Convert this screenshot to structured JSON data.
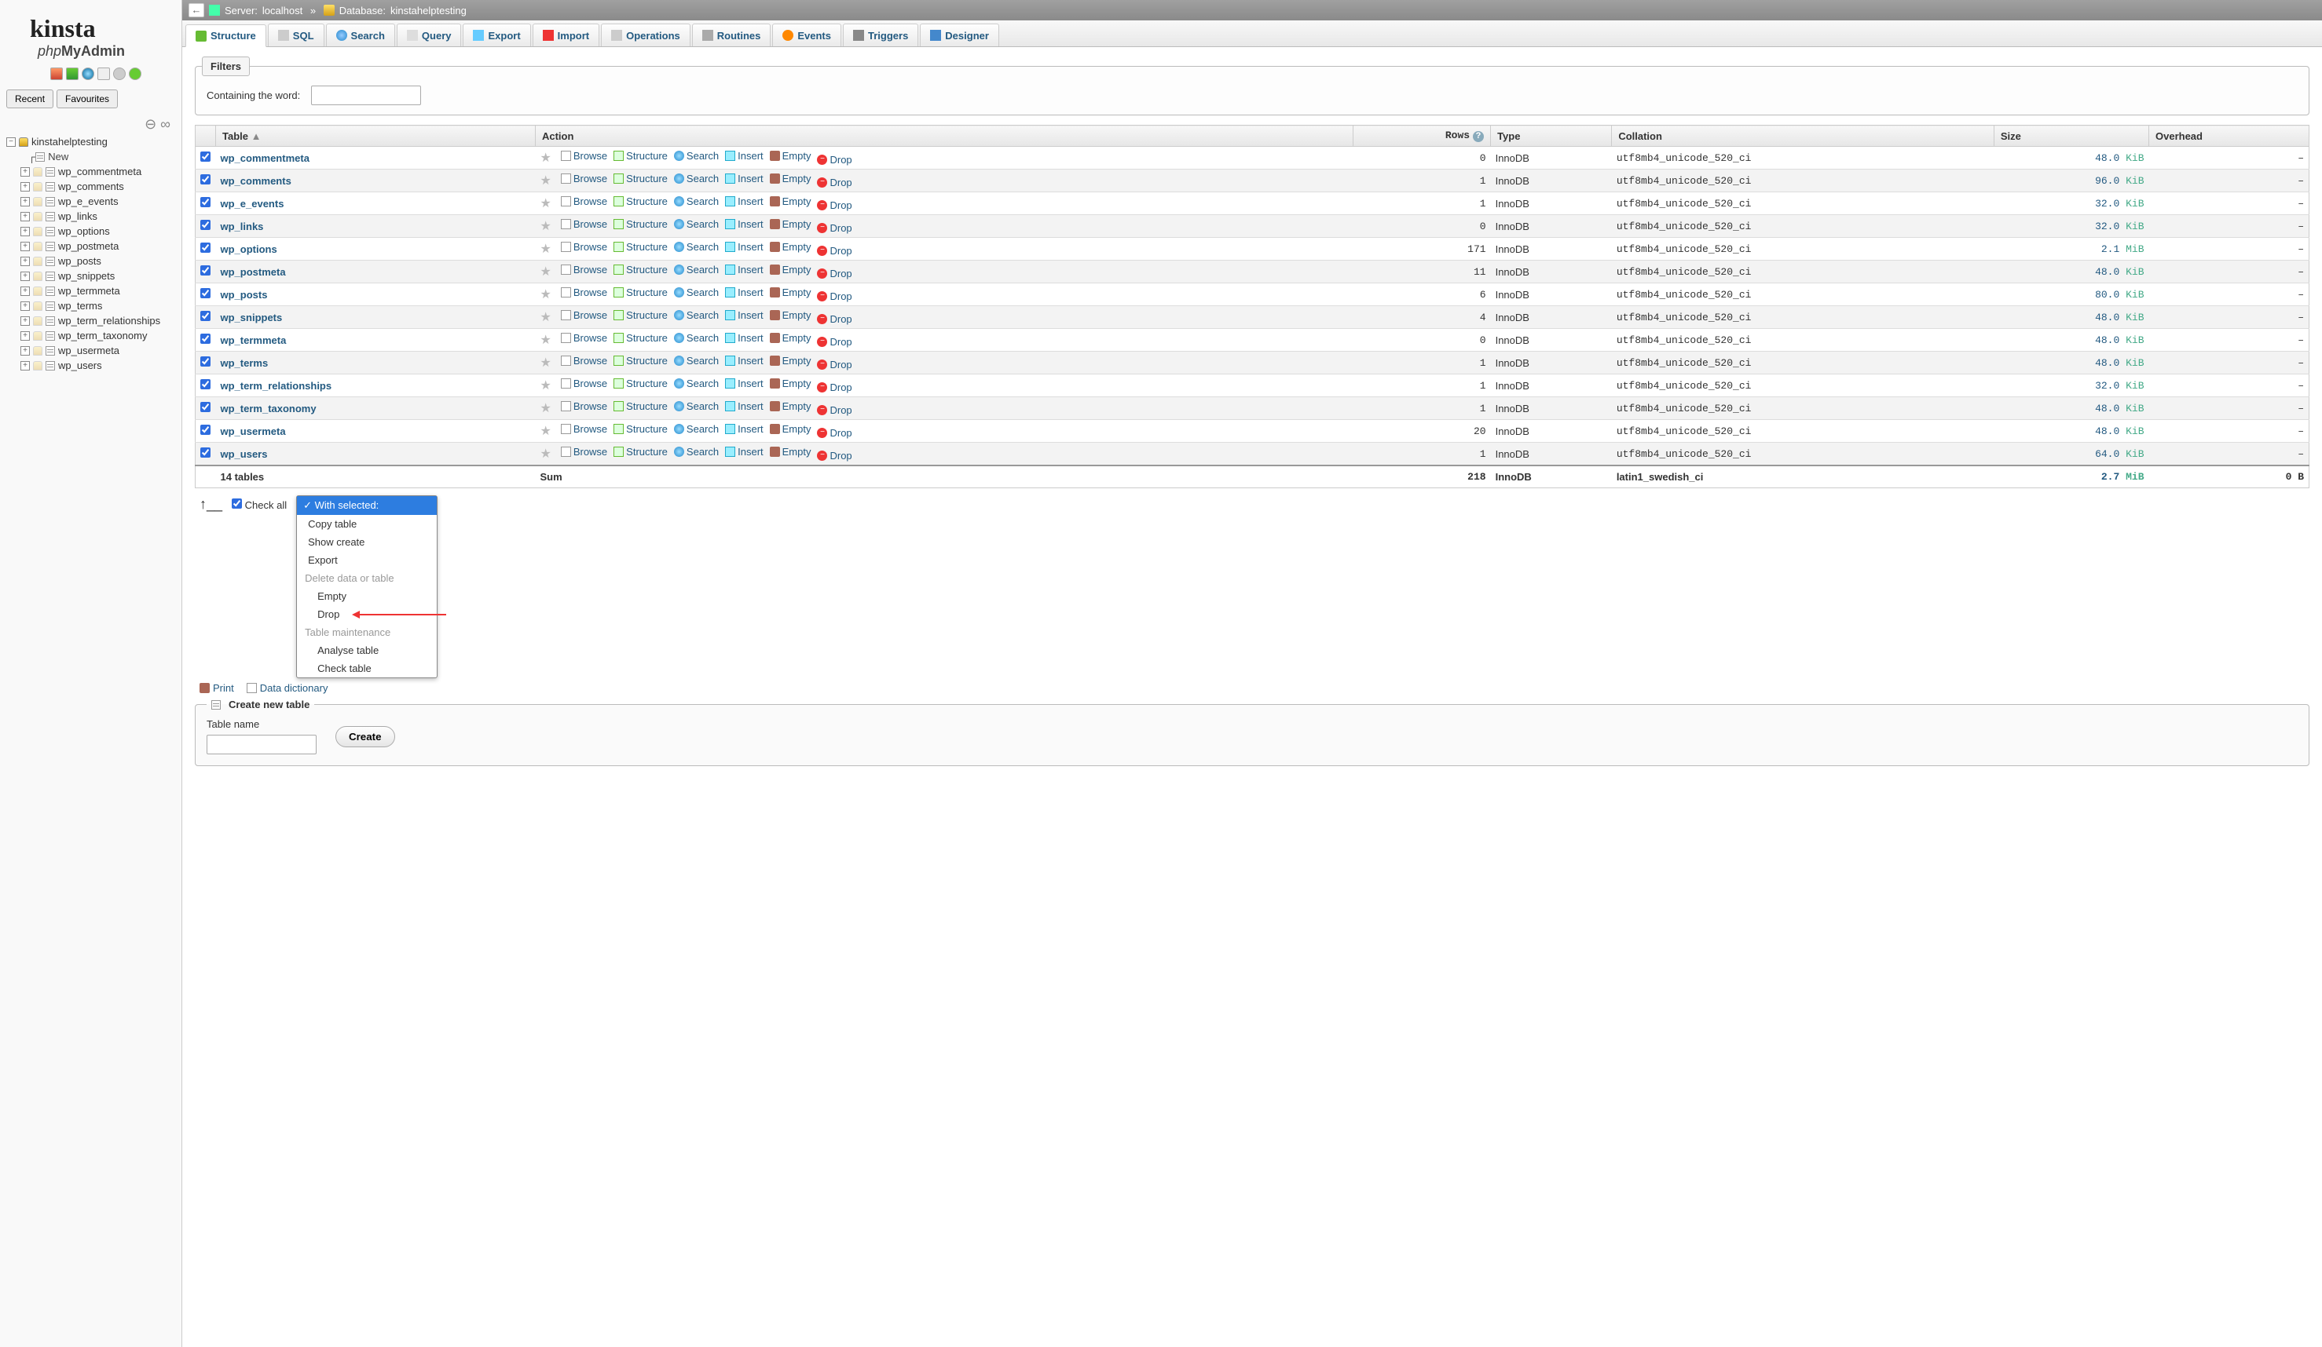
{
  "breadcrumb": {
    "server_label": "Server:",
    "server_name": "localhost",
    "db_label": "Database:",
    "db_name": "kinstahelptesting"
  },
  "tabs": [
    "Structure",
    "SQL",
    "Search",
    "Query",
    "Export",
    "Import",
    "Operations",
    "Routines",
    "Events",
    "Triggers",
    "Designer"
  ],
  "filters": {
    "legend": "Filters",
    "label": "Containing the word:"
  },
  "cols": {
    "table": "Table",
    "action": "Action",
    "rows": "Rows",
    "type": "Type",
    "collation": "Collation",
    "size": "Size",
    "overhead": "Overhead"
  },
  "action_labels": {
    "browse": "Browse",
    "structure": "Structure",
    "search": "Search",
    "insert": "Insert",
    "empty": "Empty",
    "drop": "Drop"
  },
  "rows": [
    {
      "name": "wp_commentmeta",
      "rows": 0,
      "type": "InnoDB",
      "collation": "utf8mb4_unicode_520_ci",
      "size_n": "48.0",
      "size_u": "KiB",
      "overhead": "–"
    },
    {
      "name": "wp_comments",
      "rows": 1,
      "type": "InnoDB",
      "collation": "utf8mb4_unicode_520_ci",
      "size_n": "96.0",
      "size_u": "KiB",
      "overhead": "–"
    },
    {
      "name": "wp_e_events",
      "rows": 1,
      "type": "InnoDB",
      "collation": "utf8mb4_unicode_520_ci",
      "size_n": "32.0",
      "size_u": "KiB",
      "overhead": "–"
    },
    {
      "name": "wp_links",
      "rows": 0,
      "type": "InnoDB",
      "collation": "utf8mb4_unicode_520_ci",
      "size_n": "32.0",
      "size_u": "KiB",
      "overhead": "–"
    },
    {
      "name": "wp_options",
      "rows": 171,
      "type": "InnoDB",
      "collation": "utf8mb4_unicode_520_ci",
      "size_n": "2.1",
      "size_u": "MiB",
      "overhead": "–"
    },
    {
      "name": "wp_postmeta",
      "rows": 11,
      "type": "InnoDB",
      "collation": "utf8mb4_unicode_520_ci",
      "size_n": "48.0",
      "size_u": "KiB",
      "overhead": "–"
    },
    {
      "name": "wp_posts",
      "rows": 6,
      "type": "InnoDB",
      "collation": "utf8mb4_unicode_520_ci",
      "size_n": "80.0",
      "size_u": "KiB",
      "overhead": "–"
    },
    {
      "name": "wp_snippets",
      "rows": 4,
      "type": "InnoDB",
      "collation": "utf8mb4_unicode_520_ci",
      "size_n": "48.0",
      "size_u": "KiB",
      "overhead": "–"
    },
    {
      "name": "wp_termmeta",
      "rows": 0,
      "type": "InnoDB",
      "collation": "utf8mb4_unicode_520_ci",
      "size_n": "48.0",
      "size_u": "KiB",
      "overhead": "–"
    },
    {
      "name": "wp_terms",
      "rows": 1,
      "type": "InnoDB",
      "collation": "utf8mb4_unicode_520_ci",
      "size_n": "48.0",
      "size_u": "KiB",
      "overhead": "–"
    },
    {
      "name": "wp_term_relationships",
      "rows": 1,
      "type": "InnoDB",
      "collation": "utf8mb4_unicode_520_ci",
      "size_n": "32.0",
      "size_u": "KiB",
      "overhead": "–"
    },
    {
      "name": "wp_term_taxonomy",
      "rows": 1,
      "type": "InnoDB",
      "collation": "utf8mb4_unicode_520_ci",
      "size_n": "48.0",
      "size_u": "KiB",
      "overhead": "–"
    },
    {
      "name": "wp_usermeta",
      "rows": 20,
      "type": "InnoDB",
      "collation": "utf8mb4_unicode_520_ci",
      "size_n": "48.0",
      "size_u": "KiB",
      "overhead": "–"
    },
    {
      "name": "wp_users",
      "rows": 1,
      "type": "InnoDB",
      "collation": "utf8mb4_unicode_520_ci",
      "size_n": "64.0",
      "size_u": "KiB",
      "overhead": "–"
    }
  ],
  "sum": {
    "tables_label": "14 tables",
    "action_label": "Sum",
    "rows": 218,
    "type": "InnoDB",
    "collation": "latin1_swedish_ci",
    "size_n": "2.7",
    "size_u": "MiB",
    "overhead": "0 B"
  },
  "checkall": "Check all",
  "dropdown": {
    "head": "With selected:",
    "items1": [
      "Copy table",
      "Show create",
      "Export"
    ],
    "group1": "Delete data or table",
    "items2": [
      "Empty",
      "Drop"
    ],
    "group2": "Table maintenance",
    "items3": [
      "Analyse table",
      "Check table"
    ]
  },
  "print": "Print",
  "dict": "Data dictionary",
  "newtable": {
    "legend": "Create new table",
    "name_label": "Table name",
    "create_btn": "Create"
  },
  "side": {
    "recent": "Recent",
    "fav": "Favourites",
    "db": "kinstahelptesting",
    "new": "New",
    "leaves": [
      "wp_commentmeta",
      "wp_comments",
      "wp_e_events",
      "wp_links",
      "wp_options",
      "wp_postmeta",
      "wp_posts",
      "wp_snippets",
      "wp_termmeta",
      "wp_terms",
      "wp_term_relationships",
      "wp_term_taxonomy",
      "wp_usermeta",
      "wp_users"
    ]
  }
}
